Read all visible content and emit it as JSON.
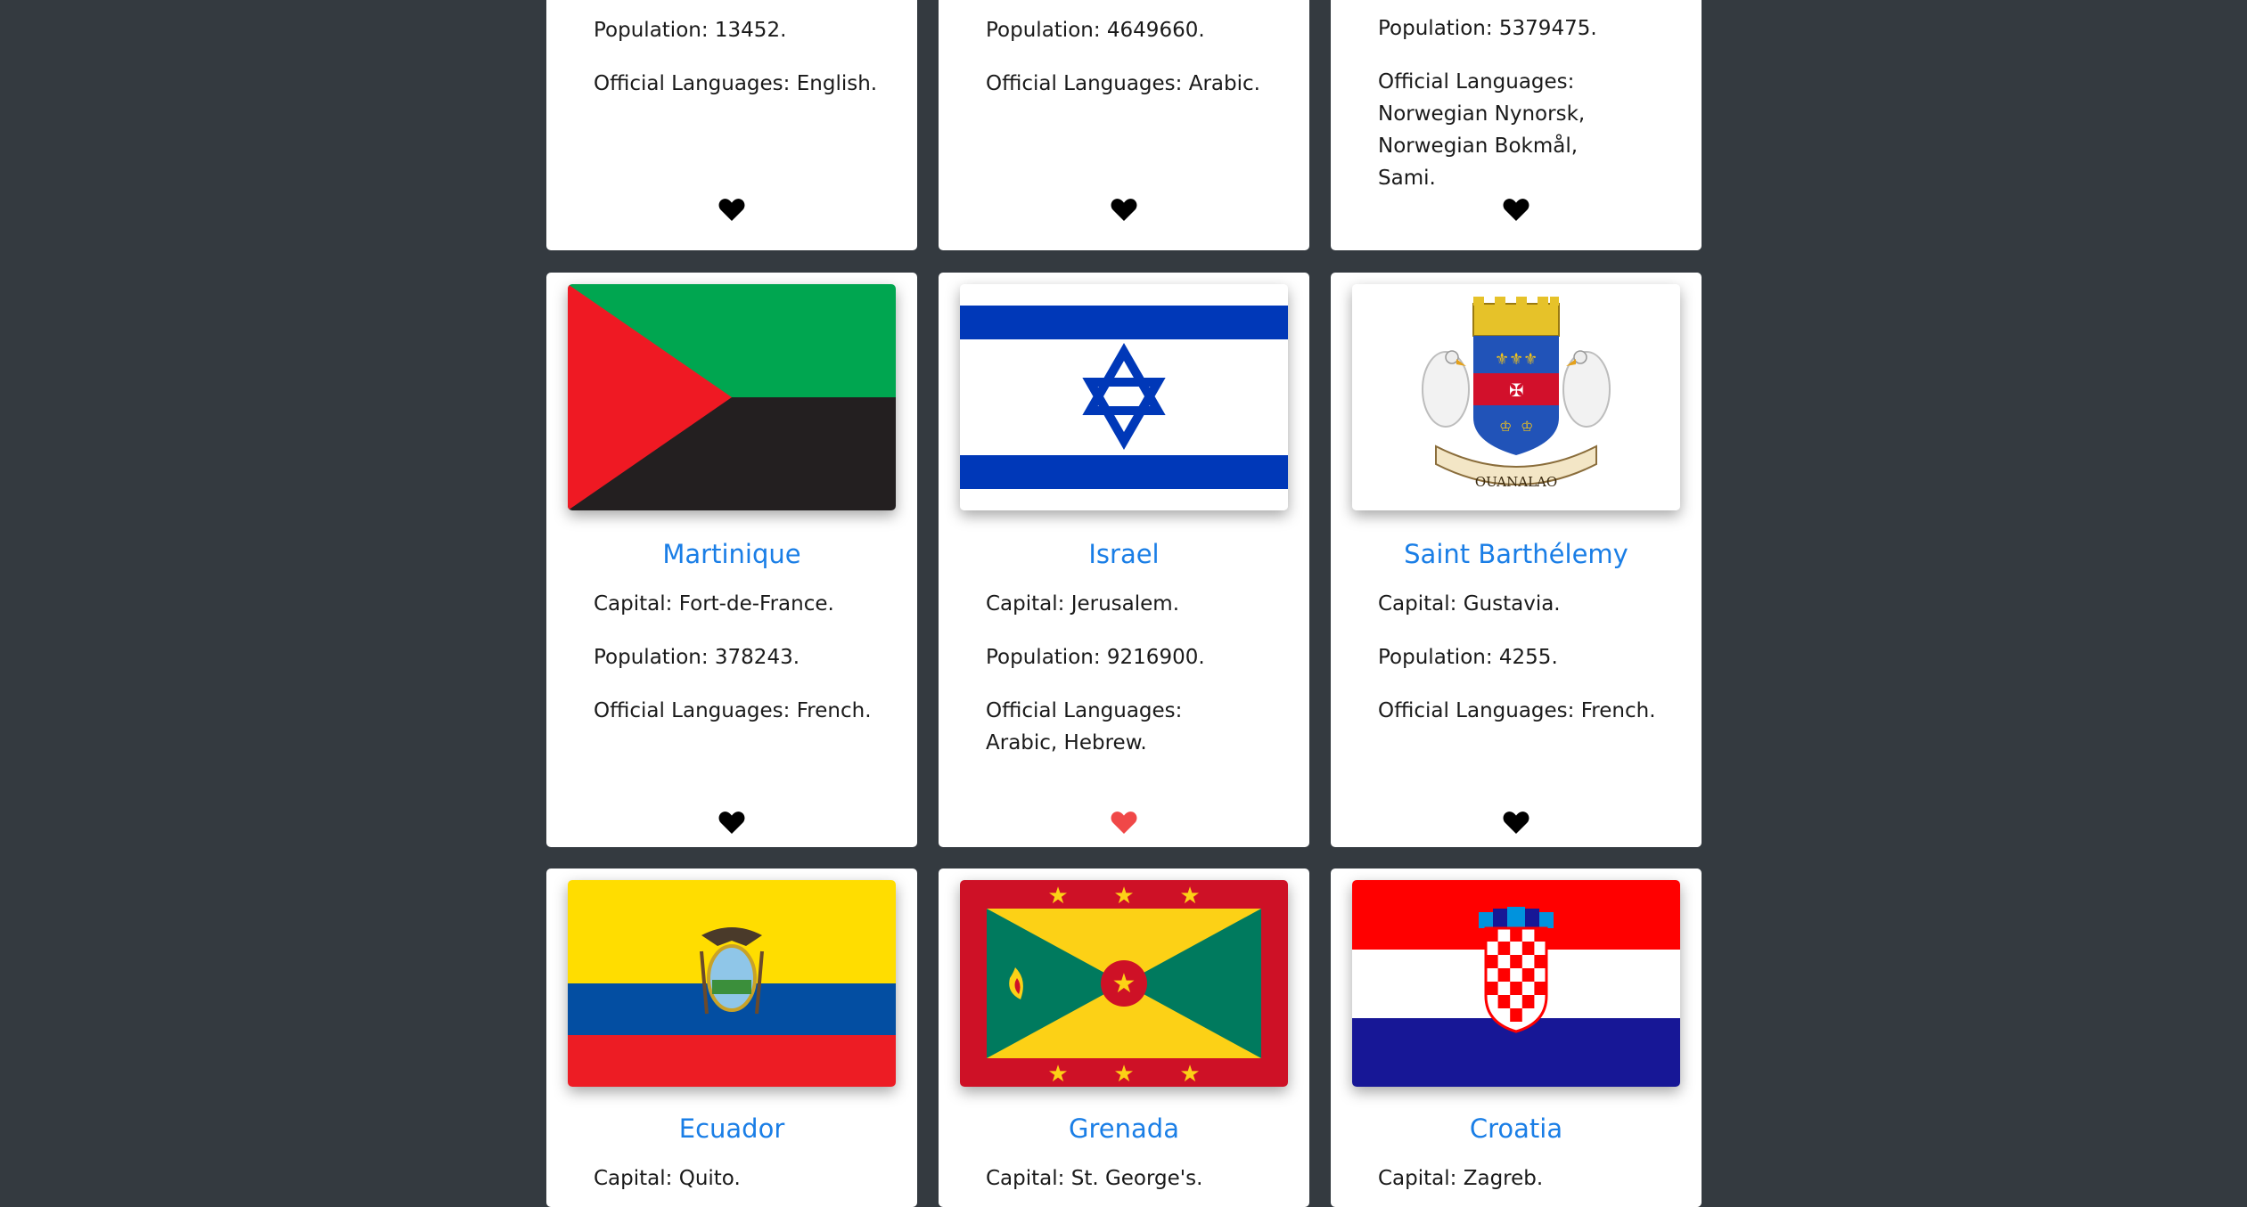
{
  "labels": {
    "capital": "Capital: ",
    "population": "Population: ",
    "languages": "Official Languages: "
  },
  "colors": {
    "background": "#343a40",
    "card": "#ffffff",
    "country_name": "#1a7ee6",
    "heart_default": "#000000",
    "heart_favorited": "#f04848"
  },
  "cards": [
    {
      "population": "13452.",
      "languages": "English.",
      "favorited": false,
      "heart_icon": "heart-icon"
    },
    {
      "population": "4649660.",
      "languages": "Arabic.",
      "favorited": false,
      "heart_icon": "heart-icon"
    },
    {
      "population": "5379475.",
      "languages": "Norwegian Nynorsk, Norwegian Bokmål, Sami.",
      "favorited": false,
      "heart_icon": "heart-icon"
    },
    {
      "name": "Martinique",
      "capital": "Fort-de-France.",
      "population": "378243.",
      "languages": "French.",
      "favorited": false,
      "flag_icon": "martinique-flag"
    },
    {
      "name": "Israel",
      "capital": "Jerusalem.",
      "population": "9216900.",
      "languages": "Arabic, Hebrew.",
      "favorited": true,
      "flag_icon": "israel-flag"
    },
    {
      "name": "Saint Barthélemy",
      "capital": "Gustavia.",
      "population": "4255.",
      "languages": "French.",
      "favorited": false,
      "flag_icon": "saint-barthelemy-coat-of-arms",
      "flag_text": "OUANALAO"
    },
    {
      "name": "Ecuador",
      "capital": "Quito.",
      "flag_icon": "ecuador-flag"
    },
    {
      "name": "Grenada",
      "capital": "St. George's.",
      "flag_icon": "grenada-flag"
    },
    {
      "name": "Croatia",
      "capital": "Zagreb.",
      "flag_icon": "croatia-flag"
    }
  ]
}
